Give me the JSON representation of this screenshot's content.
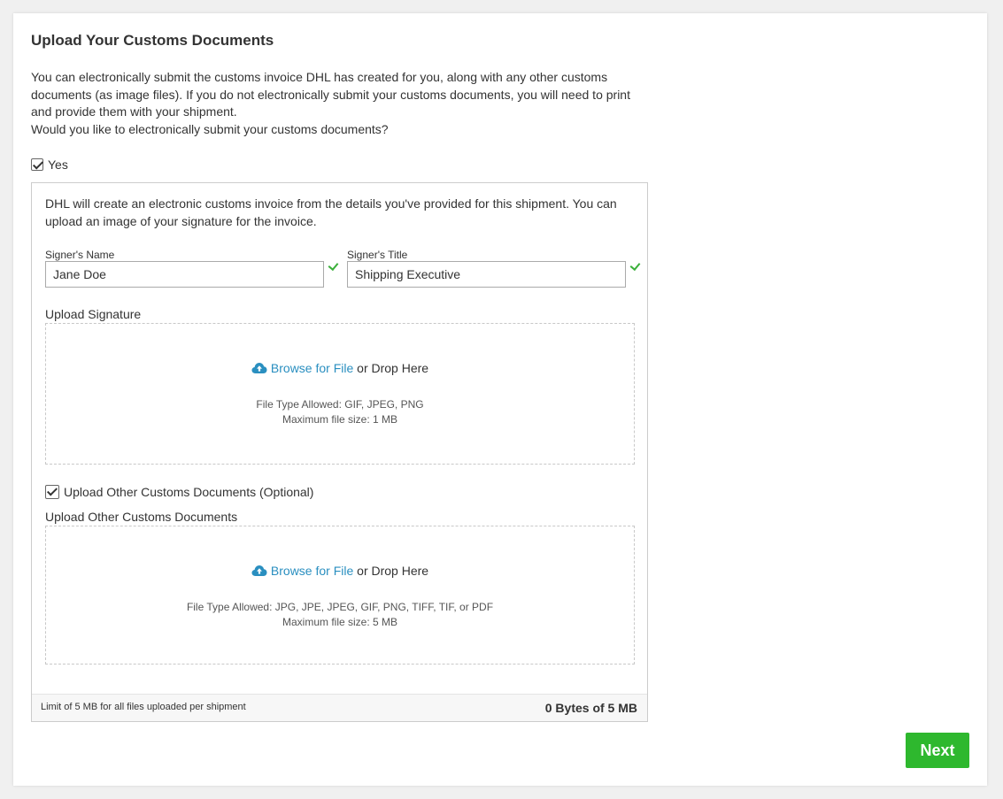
{
  "page": {
    "title": "Upload Your Customs Documents",
    "intro_lines": [
      "You can electronically submit the customs invoice DHL has created for you, along with any other customs documents (as image files). If you do not electronically submit your customs documents, you will need to print and provide them with your shipment.",
      "Would you like to electronically submit your customs documents?"
    ],
    "yes_label": "Yes",
    "yes_checked": true
  },
  "invoice": {
    "description": "DHL will create an electronic customs invoice from the details you've provided for this shipment. You can upload an image of your signature for the invoice.",
    "signer_name_label": "Signer's Name",
    "signer_name_value": "Jane Doe",
    "signer_title_label": "Signer's Title",
    "signer_title_value": "Shipping Executive"
  },
  "signature_upload": {
    "label": "Upload Signature",
    "browse_text": "Browse for File",
    "drop_text": " or Drop Here",
    "file_types": "File Type Allowed: GIF, JPEG, PNG",
    "max_size": "Maximum file size: 1 MB"
  },
  "other_docs": {
    "checkbox_label": "Upload Other Customs Documents (Optional)",
    "checked": true,
    "label": "Upload Other Customs Documents",
    "browse_text": "Browse for File",
    "drop_text": " or Drop Here",
    "file_types": "File Type Allowed: JPG, JPE, JPEG, GIF, PNG, TIFF, TIF, or PDF",
    "max_size": "Maximum file size: 5 MB"
  },
  "footer": {
    "limit_text": "Limit of 5 MB for all files uploaded per shipment",
    "usage_text": "0 Bytes of 5 MB"
  },
  "actions": {
    "next_label": "Next"
  },
  "colors": {
    "accent_link": "#2a8fc0",
    "success_green": "#3bb03b",
    "next_button": "#2eb82e"
  }
}
